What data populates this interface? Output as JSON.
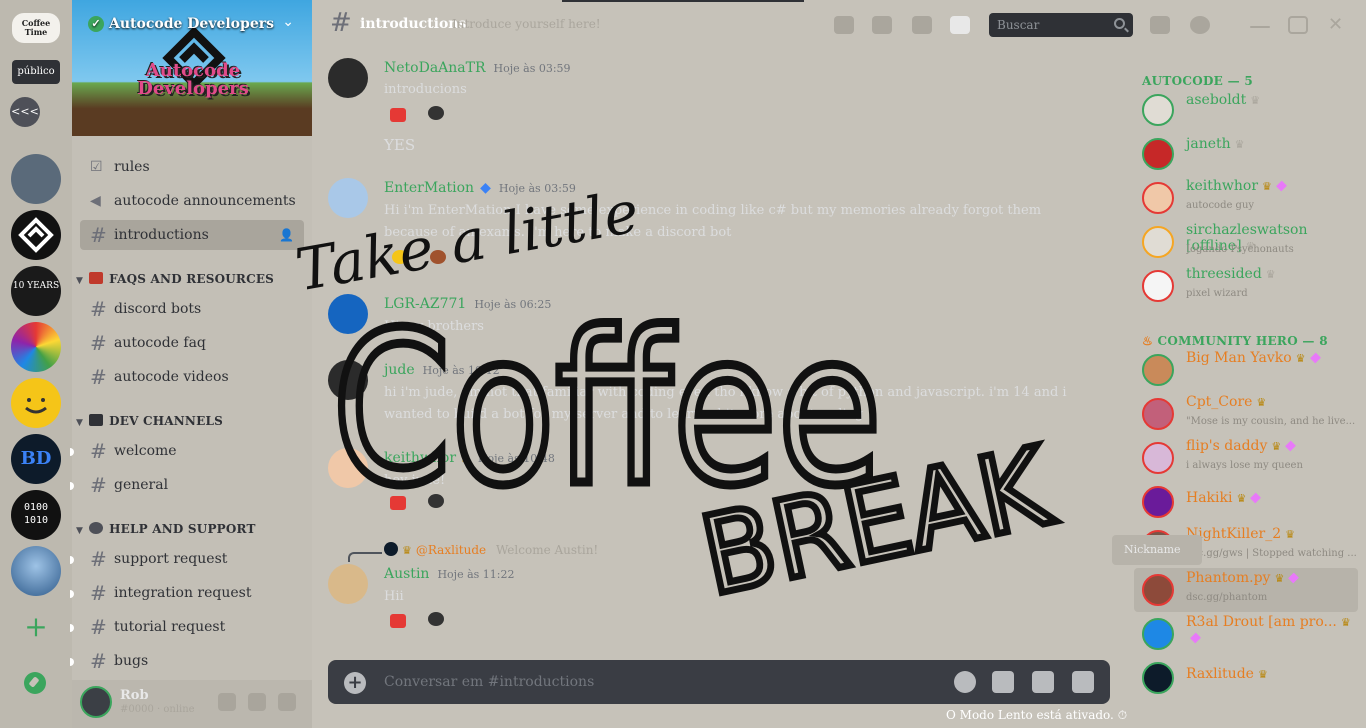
{
  "rail": {
    "brand_text": "Coffee Time",
    "public_label": "público",
    "collapse_label": "<<<",
    "servers": [
      {
        "name": "server-landscape",
        "color": "#5a6a7a",
        "label": ""
      },
      {
        "name": "server-autocode",
        "color": "#111111",
        "label": ""
      },
      {
        "name": "server-10-years",
        "color": "#1a1a1a",
        "label": "10 YEARS"
      },
      {
        "name": "server-rainbow",
        "color": "#8bc34a",
        "label": ""
      },
      {
        "name": "server-smiley",
        "color": "#f5c518",
        "label": ""
      },
      {
        "name": "server-bd",
        "color": "#0d1b2a",
        "label": "BD"
      },
      {
        "name": "server-binary",
        "color": "#111111",
        "label": "0100 1010"
      },
      {
        "name": "server-profile",
        "color": "#3b6fa8",
        "label": ""
      }
    ],
    "add_label": "+"
  },
  "sidebar": {
    "server_name": "Autocode Developers",
    "banner_title": "Autocode Developers",
    "channels_top": [
      {
        "label": "rules",
        "icon": "rules-icon"
      },
      {
        "label": "autocode announcements",
        "icon": "megaphone-icon"
      },
      {
        "label": "introductions",
        "icon": "hash-icon",
        "active": true
      }
    ],
    "categories": [
      {
        "label": "FAQS AND RESOURCES",
        "color": "#c0392b",
        "channels": [
          "discord bots",
          "autocode faq",
          "autocode videos"
        ]
      },
      {
        "label": "DEV CHANNELS",
        "color": "#2f3136",
        "channels": [
          "welcome",
          "general"
        ]
      },
      {
        "label": "HELP AND SUPPORT",
        "color": "#4e5058",
        "channels": [
          "support request",
          "integration request",
          "tutorial request",
          "bugs"
        ]
      }
    ],
    "user": {
      "name": "Rob",
      "status": "#0000 · online"
    }
  },
  "header": {
    "channel": "introductions",
    "topic": "Introduce yourself here!",
    "search_placeholder": "Buscar"
  },
  "messages": [
    {
      "author": "NetoDaAnaTR",
      "time": "Hoje às 03:59",
      "text": "introducions",
      "followup": "YES",
      "color": "#3ba55d",
      "avatar": "#2b2b2b"
    },
    {
      "author": "EnterMation",
      "time": "Hoje às 03:59",
      "text": "Hi i'm EnterMation I have some experience in coding like c# but my memories already forgot them because of an exams. I'm here to make a discord bot",
      "color": "#3ba55d",
      "avatar": "#a9c8e8"
    },
    {
      "author": "LGR-AZ771",
      "time": "Hoje às 06:25",
      "text": "Hi my brothers",
      "color": "#3ba55d",
      "avatar": "#1565c0"
    },
    {
      "author": "jude",
      "time": "Hoje às 10:12",
      "text": "hi i'm jude, i'm not that familiar with coding even tho i know a bit of python and javascript. i'm 14 and i wanted to build a bot for my server and to learn a bit more about coding",
      "color": "#3ba55d",
      "avatar": "#2b2b2b"
    },
    {
      "author": "keithwhor",
      "time": "Hoje às 10:48",
      "text": "hey jude!",
      "color": "#3ba55d",
      "avatar": "#f0c8a8"
    },
    {
      "reply_author": "@Raxlitude",
      "reply_text": "Welcome Austin!",
      "author": "Austin",
      "time": "Hoje às 11:22",
      "text": "Hii",
      "color": "#3ba55d",
      "avatar": "#d9b98a"
    }
  ],
  "composer": {
    "placeholder": "Conversar em #introductions",
    "slowmode": "O Modo Lento está ativado."
  },
  "members": {
    "groups": [
      {
        "label": "AUTOCODE — 5",
        "color": "#3ba55d",
        "items": [
          {
            "name": "aseboldt",
            "sub": "",
            "color": "#3ba55d",
            "crown": false
          },
          {
            "name": "janeth",
            "sub": "",
            "color": "#3ba55d",
            "crown": false
          },
          {
            "name": "keithwhor",
            "sub": "autocode guy",
            "color": "#3ba55d",
            "crown": true,
            "gem": true
          },
          {
            "name": "sirchazleswatson [offline]",
            "sub": "Jogando Psychonauts",
            "color": "#3ba55d",
            "crown": false
          },
          {
            "name": "threesided",
            "sub": "pixel wizard",
            "color": "#3ba55d",
            "crown": false
          }
        ]
      },
      {
        "label": "COMMUNITY HERO — 8",
        "color": "#3ba55d",
        "items": [
          {
            "name": "Big Man Yavko",
            "sub": "",
            "color": "#e67e22",
            "crown": true,
            "gem": true
          },
          {
            "name": "Cpt_Core",
            "sub": "\"Mose is my cousin, and he live...",
            "color": "#e67e22",
            "crown": true
          },
          {
            "name": "flip's daddy",
            "sub": "i always lose my queen",
            "color": "#e67e22",
            "crown": true,
            "gem": true
          },
          {
            "name": "Hakiki",
            "sub": "",
            "color": "#e67e22",
            "crown": true,
            "gem": true
          },
          {
            "name": "NightKiller_2",
            "sub": "dsc.gg/gws | Stopped watching ...",
            "color": "#e67e22",
            "crown": true
          },
          {
            "name": "Phantom.py",
            "sub": "dsc.gg/phantom",
            "color": "#e67e22",
            "crown": true,
            "gem": true
          },
          {
            "name": "R3al Drout [am pro...",
            "sub": "",
            "color": "#e67e22",
            "crown": true,
            "gem": true
          },
          {
            "name": "Raxlitude",
            "sub": "",
            "color": "#e67e22",
            "crown": true
          }
        ]
      }
    ],
    "tooltip": "Nickname"
  },
  "overlay": {
    "line1": "Take a little",
    "line2": "Coffee",
    "line3": "BREAK"
  }
}
